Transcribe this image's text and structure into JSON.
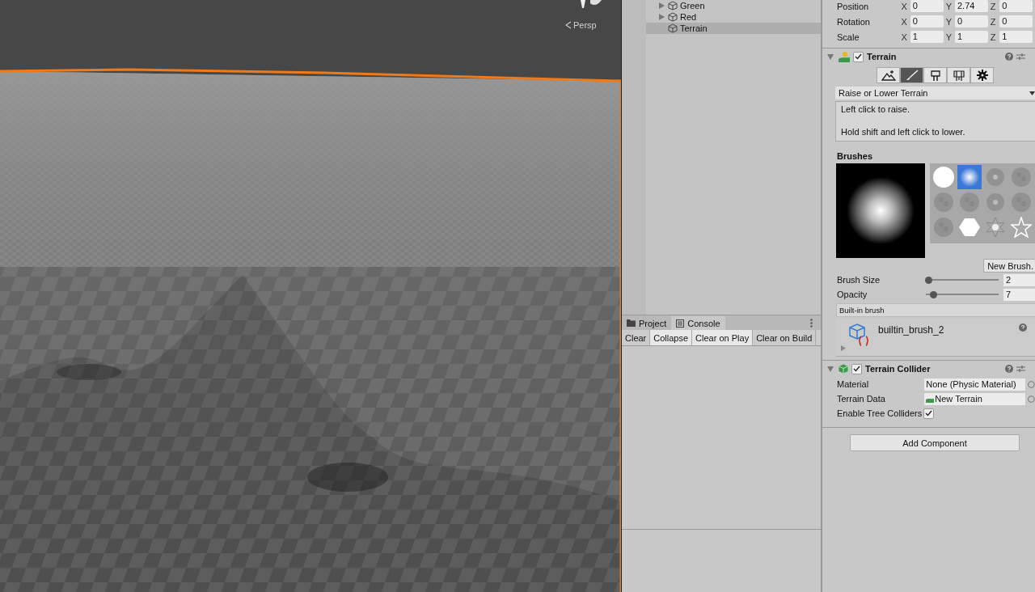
{
  "scene_view": {
    "camera_mode": "Persp"
  },
  "hierarchy": {
    "items": [
      {
        "name": "Green",
        "expandable": true,
        "selected": false
      },
      {
        "name": "Red",
        "expandable": true,
        "selected": false
      },
      {
        "name": "Terrain",
        "expandable": false,
        "selected": true
      }
    ]
  },
  "console_panel": {
    "tabs": [
      {
        "label": "Project",
        "kind": "folder",
        "selected": false
      },
      {
        "label": "Console",
        "kind": "console",
        "selected": true
      }
    ],
    "toolbar": [
      {
        "label": "Clear",
        "on": false
      },
      {
        "label": "Collapse",
        "on": true
      },
      {
        "label": "Clear on Play",
        "on": true
      },
      {
        "label": "Clear on Build",
        "on": false
      }
    ]
  },
  "inspector": {
    "transform": [
      {
        "label": "Position",
        "axes": [
          {
            "axis": "X",
            "value": "0"
          },
          {
            "axis": "Y",
            "value": "2.74"
          },
          {
            "axis": "Z",
            "value": "0"
          }
        ]
      },
      {
        "label": "Rotation",
        "axes": [
          {
            "axis": "X",
            "value": "0"
          },
          {
            "axis": "Y",
            "value": "0"
          },
          {
            "axis": "Z",
            "value": "0"
          }
        ]
      },
      {
        "label": "Scale",
        "axes": [
          {
            "axis": "X",
            "value": "1"
          },
          {
            "axis": "Y",
            "value": "1"
          },
          {
            "axis": "Z",
            "value": "1"
          }
        ]
      }
    ],
    "terrain": {
      "title": "Terrain",
      "enabled": true,
      "tools": [
        {
          "kind": "sculpt",
          "selected": false
        },
        {
          "kind": "paint",
          "selected": true
        },
        {
          "kind": "trees",
          "selected": false
        },
        {
          "kind": "details",
          "selected": false
        },
        {
          "kind": "settings",
          "selected": false
        }
      ],
      "tool_mode": "Raise or Lower Terrain",
      "help": [
        "Left click to raise.",
        "Hold shift and left click to lower."
      ],
      "brushes_label": "Brushes",
      "brushes": [
        {
          "kind": "circle",
          "selected": false
        },
        {
          "kind": "soft",
          "selected": true
        },
        {
          "kind": "speck",
          "selected": false
        },
        {
          "kind": "blob",
          "selected": false
        },
        {
          "kind": "blob",
          "selected": false
        },
        {
          "kind": "blob",
          "selected": false
        },
        {
          "kind": "speck",
          "selected": false
        },
        {
          "kind": "blob",
          "selected": false
        },
        {
          "kind": "blob",
          "selected": false
        },
        {
          "kind": "hexagon",
          "selected": false
        },
        {
          "kind": "star6",
          "selected": false
        },
        {
          "kind": "star",
          "selected": false
        }
      ],
      "new_brush_button": "New Brush.",
      "sliders": [
        {
          "label": "Brush Size",
          "level": 0,
          "value": "2"
        },
        {
          "label": "Opacity",
          "level": 0.07,
          "value": "7"
        }
      ],
      "brush_header": "Built-in brush",
      "brush_asset": "builtin_brush_2"
    },
    "terrain_collider": {
      "title": "Terrain Collider",
      "enabled": true,
      "fields": [
        {
          "label": "Material",
          "value": "None (Physic Material)",
          "kind": "object"
        },
        {
          "label": "Terrain Data",
          "value": "New Terrain",
          "kind": "asset"
        }
      ],
      "enable_tree_colliders": {
        "label": "Enable Tree Colliders",
        "checked": true
      }
    },
    "add_component_button": "Add Component"
  }
}
